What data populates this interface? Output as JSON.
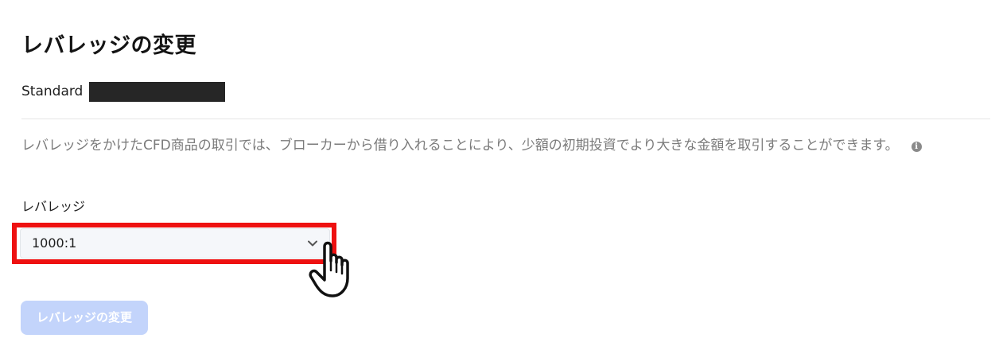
{
  "page": {
    "title": "レバレッジの変更"
  },
  "account": {
    "type": "Standard"
  },
  "description": {
    "text": "レバレッジをかけたCFD商品の取引では、ブローカーから借り入れることにより、少額の初期投資でより大きな金額を取引することができます。",
    "info_icon": "info-icon"
  },
  "leverage_field": {
    "label": "レバレッジ",
    "selected_value": "1000:1"
  },
  "submit": {
    "label": "レバレッジの変更",
    "disabled": true
  },
  "colors": {
    "highlight": "#ee1111",
    "button_disabled": "#c3d4fb",
    "description_text": "#7b7b7b"
  }
}
